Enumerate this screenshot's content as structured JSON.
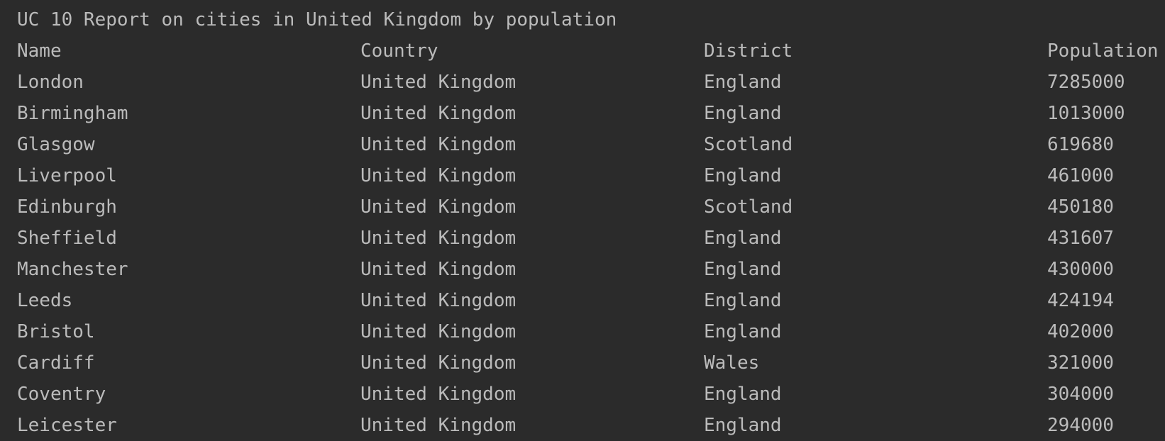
{
  "report": {
    "title": "UC 10 Report on cities in United Kingdom by population",
    "headers": [
      "Name",
      "Country",
      "District",
      "Population"
    ],
    "rows": [
      [
        "London",
        "United Kingdom",
        "England",
        "7285000"
      ],
      [
        "Birmingham",
        "United Kingdom",
        "England",
        "1013000"
      ],
      [
        "Glasgow",
        "United Kingdom",
        "Scotland",
        "619680"
      ],
      [
        "Liverpool",
        "United Kingdom",
        "England",
        "461000"
      ],
      [
        "Edinburgh",
        "United Kingdom",
        "Scotland",
        "450180"
      ],
      [
        "Sheffield",
        "United Kingdom",
        "England",
        "431607"
      ],
      [
        "Manchester",
        "United Kingdom",
        "England",
        "430000"
      ],
      [
        "Leeds",
        "United Kingdom",
        "England",
        "424194"
      ],
      [
        "Bristol",
        "United Kingdom",
        "England",
        "402000"
      ],
      [
        "Cardiff",
        "United Kingdom",
        "Wales",
        "321000"
      ],
      [
        "Coventry",
        "United Kingdom",
        "England",
        "304000"
      ],
      [
        "Leicester",
        "United Kingdom",
        "England",
        "294000"
      ]
    ]
  },
  "colors": {
    "background": "#2b2b2b",
    "text": "#bbbbbb"
  }
}
